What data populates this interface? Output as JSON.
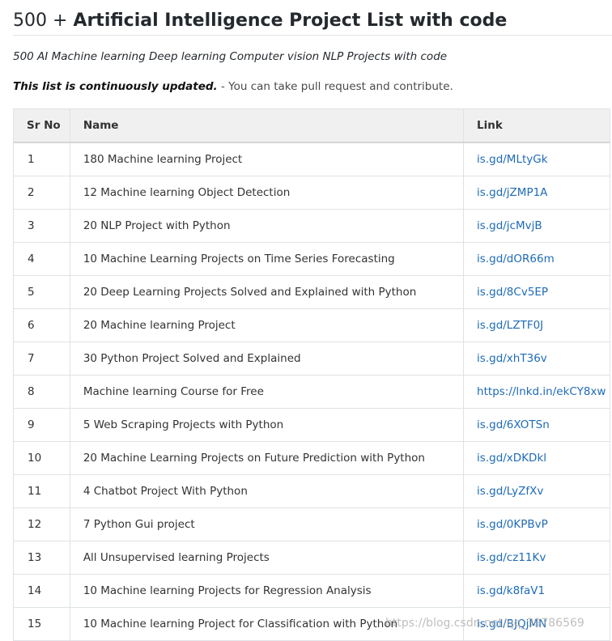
{
  "page": {
    "title_prefix": "500 + ",
    "title_strong": "Artificial Intelligence Project List with code",
    "subtitle": "500 AI Machine learning Deep learning Computer vision NLP Projects with code",
    "notice_bold": "This list is continuously updated.",
    "notice_rest": " - You can take pull request and contribute."
  },
  "table": {
    "headers": [
      "Sr No",
      "Name",
      "Link"
    ],
    "rows": [
      {
        "no": "1",
        "name": "180 Machine learning Project",
        "link": "is.gd/MLtyGk"
      },
      {
        "no": "2",
        "name": "12 Machine learning Object Detection",
        "link": "is.gd/jZMP1A"
      },
      {
        "no": "3",
        "name": "20 NLP Project with Python",
        "link": "is.gd/jcMvjB"
      },
      {
        "no": "4",
        "name": "10 Machine Learning Projects on Time Series Forecasting",
        "link": "is.gd/dOR66m"
      },
      {
        "no": "5",
        "name": "20 Deep Learning Projects Solved and Explained with Python",
        "link": "is.gd/8Cv5EP"
      },
      {
        "no": "6",
        "name": "20 Machine learning Project",
        "link": "is.gd/LZTF0J"
      },
      {
        "no": "7",
        "name": "30 Python Project Solved and Explained",
        "link": "is.gd/xhT36v"
      },
      {
        "no": "8",
        "name": "Machine learning Course for Free",
        "link": "https://lnkd.in/ekCY8xw"
      },
      {
        "no": "9",
        "name": "5 Web Scraping Projects with Python",
        "link": "is.gd/6XOTSn"
      },
      {
        "no": "10",
        "name": "20 Machine Learning Projects on Future Prediction with Python",
        "link": "is.gd/xDKDkl"
      },
      {
        "no": "11",
        "name": "4 Chatbot Project With Python",
        "link": "is.gd/LyZfXv"
      },
      {
        "no": "12",
        "name": "7 Python Gui project",
        "link": "is.gd/0KPBvP"
      },
      {
        "no": "13",
        "name": "All Unsupervised learning Projects",
        "link": "is.gd/cz11Kv"
      },
      {
        "no": "14",
        "name": "10 Machine learning Projects for Regression Analysis",
        "link": "is.gd/k8faV1"
      },
      {
        "no": "15",
        "name": "10 Machine learning Project for Classification with Python",
        "link": "is.gd/BJQjMN"
      }
    ]
  },
  "watermark": "https://blog.csdn.net/qq_39786569",
  "colors": {
    "link": "#1e6bb8",
    "header_bg": "#f0f0f0",
    "border": "#dfe2e5"
  }
}
